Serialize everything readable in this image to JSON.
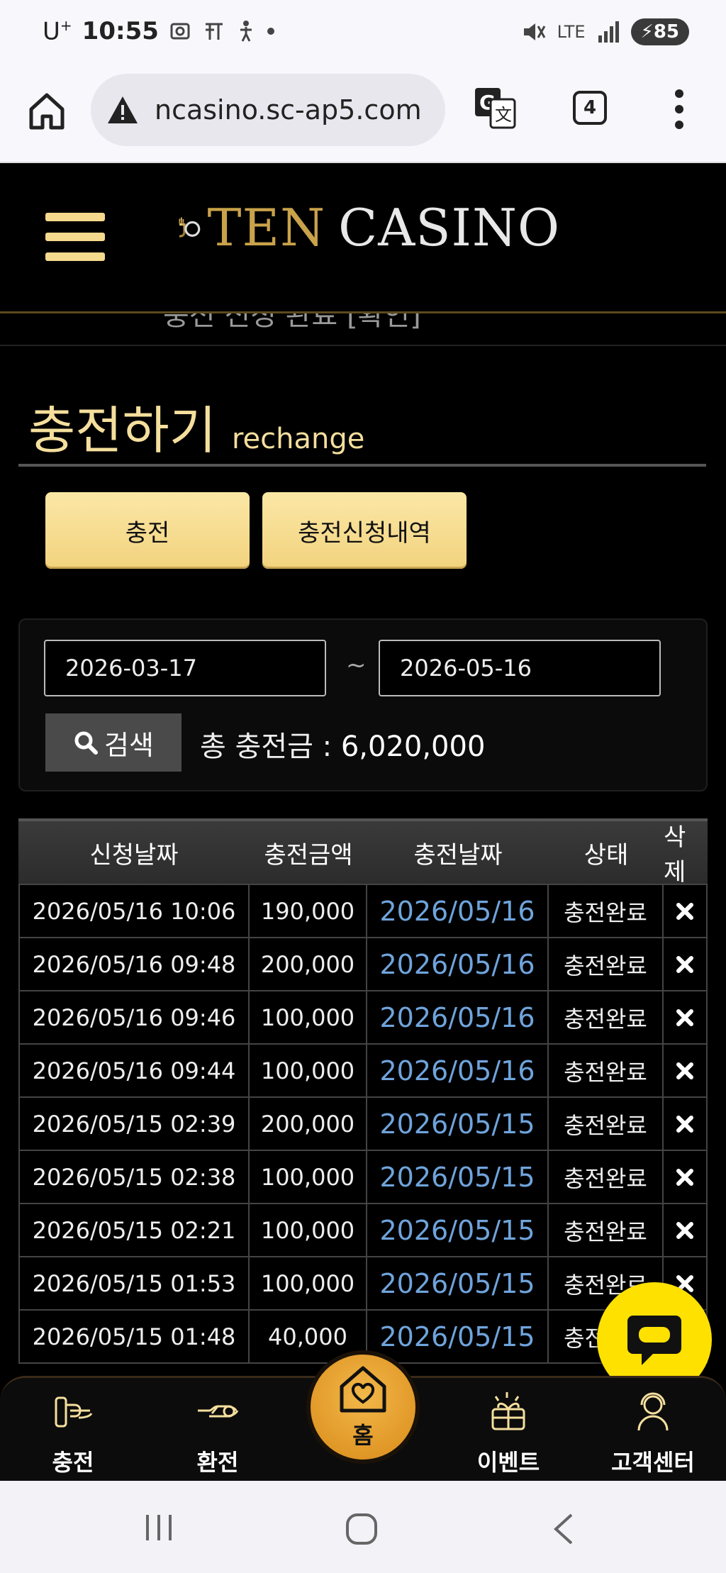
{
  "status": {
    "carrier": "U",
    "carrier_sup": "+",
    "time": "10:55",
    "network": "LTE",
    "battery": "85"
  },
  "browser": {
    "url": "ncasino.sc-ap5.com",
    "tab_count": "4"
  },
  "site": {
    "logo_ten": "TEN",
    "logo_casino": "CASINO",
    "ticker": "충전 신청 완료 [확인]"
  },
  "page": {
    "title_ko": "충전하기",
    "title_en": "rechange"
  },
  "tabs": {
    "charge": "충전",
    "history": "충전신청내역"
  },
  "search": {
    "date_from": "2026-03-17",
    "date_to": "2026-05-16",
    "tilde": "~",
    "button": "검색",
    "total_label": "총 충전금 : ",
    "total_value": "6,020,000"
  },
  "table": {
    "headers": [
      "신청날짜",
      "충전금액",
      "충전날짜",
      "상태",
      "삭제"
    ],
    "rows": [
      {
        "requested": "2026/05/16 10:06",
        "amount": "190,000",
        "charged": "2026/05/16",
        "status": "충전완료"
      },
      {
        "requested": "2026/05/16 09:48",
        "amount": "200,000",
        "charged": "2026/05/16",
        "status": "충전완료"
      },
      {
        "requested": "2026/05/16 09:46",
        "amount": "100,000",
        "charged": "2026/05/16",
        "status": "충전완료"
      },
      {
        "requested": "2026/05/16 09:44",
        "amount": "100,000",
        "charged": "2026/05/16",
        "status": "충전완료"
      },
      {
        "requested": "2026/05/15 02:39",
        "amount": "200,000",
        "charged": "2026/05/15",
        "status": "충전완료"
      },
      {
        "requested": "2026/05/15 02:38",
        "amount": "100,000",
        "charged": "2026/05/15",
        "status": "충전완료"
      },
      {
        "requested": "2026/05/15 02:21",
        "amount": "100,000",
        "charged": "2026/05/15",
        "status": "충전완료"
      },
      {
        "requested": "2026/05/15 01:53",
        "amount": "100,000",
        "charged": "2026/05/15",
        "status": "충전완료"
      },
      {
        "requested": "2026/05/15 01:48",
        "amount": "40,000",
        "charged": "2026/05/15",
        "status": "충전완료"
      }
    ]
  },
  "bottom_nav": {
    "charge": "충전",
    "exchange": "환전",
    "home": "홈",
    "event": "이벤트",
    "support": "고객센터"
  },
  "colors": {
    "gold": "#f5df9d",
    "link_blue": "#6fa4dc",
    "chat_yellow": "#ffe100",
    "home_orange": "#e89e2c"
  }
}
